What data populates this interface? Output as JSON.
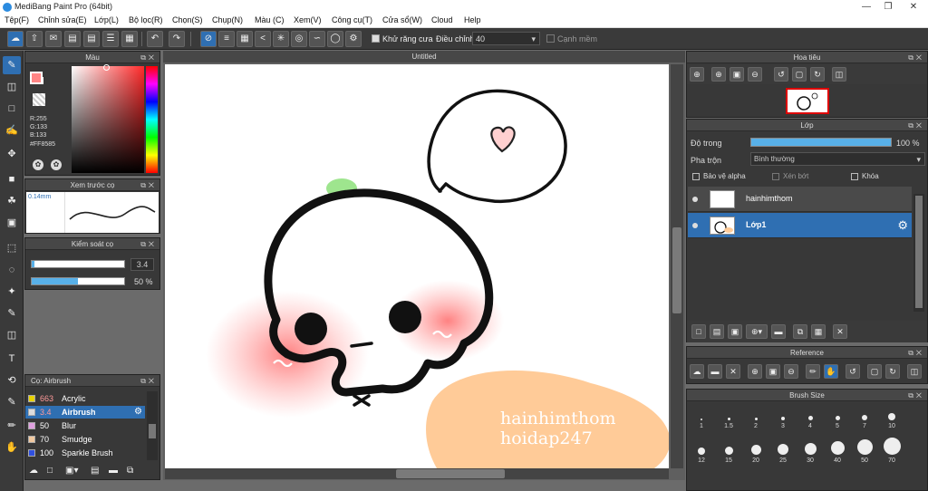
{
  "window": {
    "title": "MediBang Paint Pro (64bit)"
  },
  "menu": [
    "Tệp(F)",
    "Chỉnh sửa(E)",
    "Lớp(L)",
    "Bộ lọc(R)",
    "Chọn(S)",
    "Chụp(N)",
    "Màu (C)",
    "Xem(V)",
    "Công cụ(T)",
    "Cửa sổ(W)",
    "Cloud",
    "Help"
  ],
  "toolbar": {
    "antialias_label": "Khử răng cưa",
    "adjust_label": "Điều chỉnh",
    "adjust_value": "40",
    "smooth_label": "Cạnh mềm"
  },
  "color_panel": {
    "title": "Màu",
    "r": "R:255",
    "g": "G:133",
    "b": "B:133",
    "hex": "#FF8585",
    "fg_color": "#ff8585"
  },
  "brush_preview": {
    "title": "Xem trước cọ",
    "size": "0.14mm"
  },
  "brush_control": {
    "title": "Kiểm soát cọ",
    "size_value": "3.4",
    "opacity_value": "50 %",
    "opacity_fraction": 0.5
  },
  "brush_list": {
    "title": "Cọ: Airbrush",
    "items": [
      {
        "size": "663",
        "name": "Acrylic",
        "color": "#e8d200"
      },
      {
        "size": "3.4",
        "name": "Airbrush",
        "color": "#dddddd",
        "selected": true
      },
      {
        "size": "50",
        "name": "Blur",
        "color": "#e0a0e0"
      },
      {
        "size": "70",
        "name": "Smudge",
        "color": "#f0c8a0"
      },
      {
        "size": "100",
        "name": "Sparkle Brush",
        "color": "#3050e0"
      }
    ]
  },
  "canvas": {
    "title": "Untitled",
    "watermark1": "hainhimthom",
    "watermark2": "hoidap247"
  },
  "navigator": {
    "title": "Hoa tiêu"
  },
  "layer_panel": {
    "title": "Lớp",
    "opacity_label": "Độ trong",
    "opacity_value": "100 %",
    "opacity_fraction": 1.0,
    "blend_label": "Pha trộn",
    "blend_value": "Bình thường",
    "protect_alpha": "Bảo vệ alpha",
    "clipping": "Xén bớt",
    "lock": "Khóa",
    "layers": [
      {
        "name": "hainhimthom",
        "selected": false
      },
      {
        "name": "Lớp1",
        "selected": true
      }
    ]
  },
  "reference": {
    "title": "Reference"
  },
  "brush_size": {
    "title": "Brush Size",
    "row1": [
      "1",
      "1.5",
      "2",
      "3",
      "4",
      "5",
      "7",
      "10"
    ],
    "row2": [
      "12",
      "15",
      "20",
      "25",
      "30",
      "40",
      "50",
      "70"
    ]
  }
}
